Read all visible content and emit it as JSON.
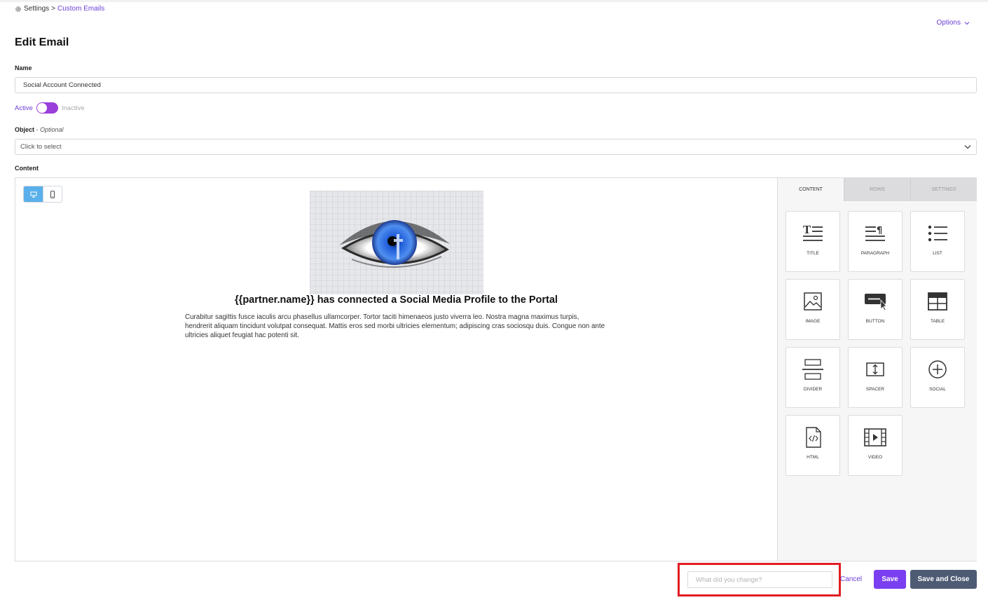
{
  "breadcrumb": {
    "root": "Settings",
    "separator": ">",
    "current": "Custom Emails"
  },
  "header": {
    "options_label": "Options",
    "title": "Edit Email"
  },
  "form": {
    "name_label": "Name",
    "name_value": "Social Account Connected",
    "toggle": {
      "active_label": "Active",
      "inactive_label": "Inactive"
    },
    "object_label": "Object",
    "object_optional": "- Optional",
    "object_placeholder": "Click to select",
    "content_label": "Content"
  },
  "editor": {
    "preview": {
      "heading": "{{partner.name}} has connected a Social Media Profile to the Portal",
      "body": "Curabitur sagittis fusce iaculis arcu phasellus ullamcorper. Tortor taciti himenaeos justo viverra leo. Nostra magna maximus turpis, hendrerit aliquam tincidunt volutpat consequat. Mattis eros sed morbi ultricies elementum; adipiscing cras sociosqu duis. Congue non ante ultricies aliquet feugiat hac potenti sit."
    },
    "tabs": [
      "CONTENT",
      "ROWS",
      "SETTINGS"
    ],
    "blocks": [
      "TITLE",
      "PARAGRAPH",
      "LIST",
      "IMAGE",
      "BUTTON",
      "TABLE",
      "DIVIDER",
      "SPACER",
      "SOCIAL",
      "HTML",
      "VIDEO"
    ]
  },
  "footer": {
    "change_placeholder": "What did you change?",
    "cancel_label": "Cancel",
    "save_label": "Save",
    "save_close_label": "Save and Close"
  },
  "colors": {
    "accent": "#7a3ff0",
    "link": "#6b3fd8",
    "highlight": "#e11d23",
    "secondary_button": "#4d5b73",
    "device_selected": "#5ab0ea"
  }
}
